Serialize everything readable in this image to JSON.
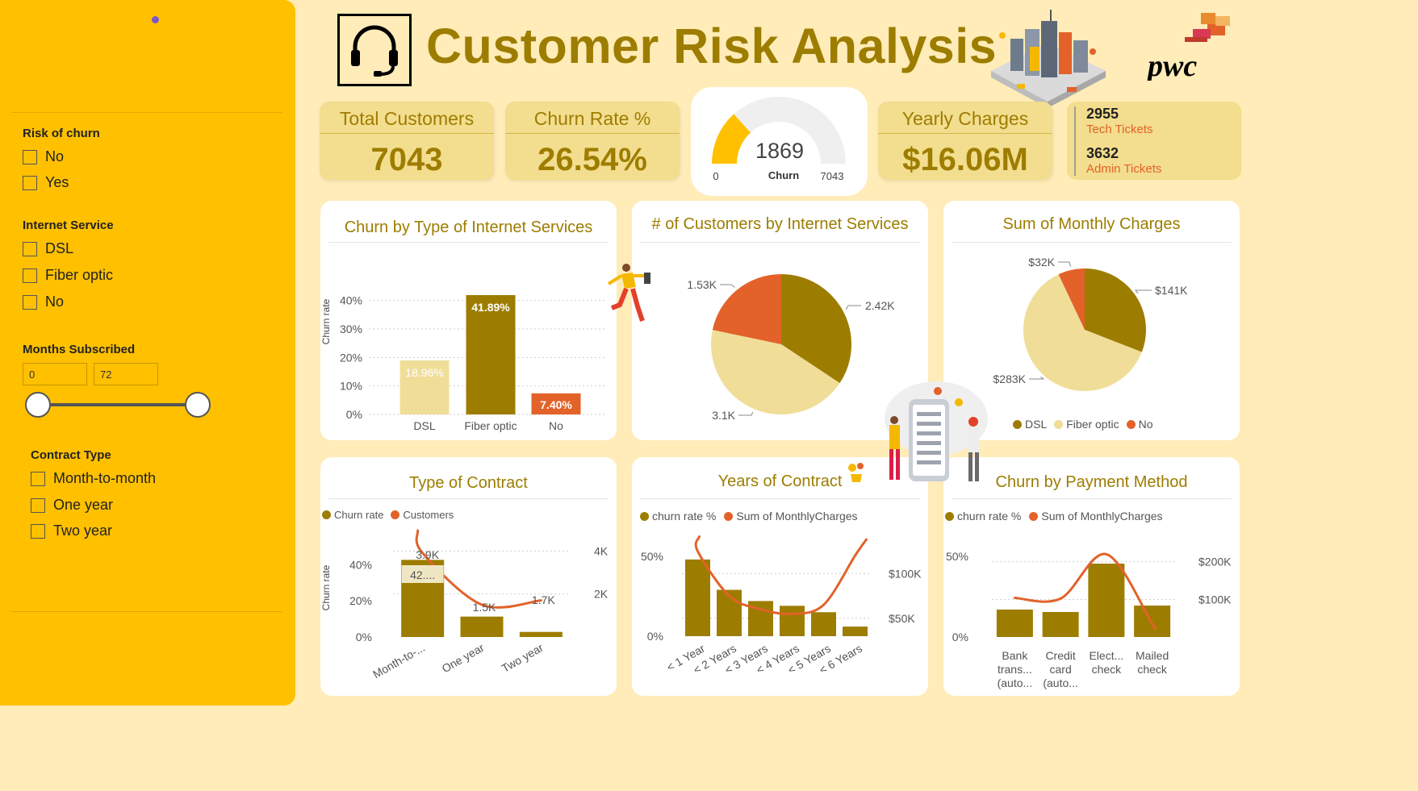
{
  "page_title": "Customer Risk Analysis",
  "pwc_logo_text": "pwc",
  "colors": {
    "sidebar": "#FFC000",
    "background": "#FFECB8",
    "olive": "#9D7D00",
    "light_gold": "#F0DE98",
    "orange": "#E2622A",
    "kpi": "#F3DD8E"
  },
  "sidebar": {
    "risk": {
      "title": "Risk of churn",
      "options": [
        "No",
        "Yes"
      ]
    },
    "internet": {
      "title": "Internet Service",
      "options": [
        "DSL",
        "Fiber optic",
        "No"
      ]
    },
    "months": {
      "title": "Months Subscribed",
      "min": "0",
      "max": "72",
      "slider_min": 0,
      "slider_max": 72,
      "range_min": 0,
      "range_max": 72
    },
    "contract": {
      "title": "Contract Type",
      "options": [
        "Month-to-month",
        "One year",
        "Two year"
      ]
    }
  },
  "kpis": {
    "total_customers": {
      "label": "Total Customers",
      "value": "7043"
    },
    "churn_rate": {
      "label": "Churn Rate %",
      "value": "26.54%"
    },
    "yearly_charges": {
      "label": "Yearly Charges",
      "value": "$16.06M"
    }
  },
  "gauge": {
    "value": "1869",
    "label": "Churn",
    "min": "0",
    "max": "7043",
    "value_num": 1869,
    "max_num": 7043
  },
  "tickets": {
    "tech_count": "2955",
    "tech_label": "Tech Tickets",
    "admin_count": "3632",
    "admin_label": "Admin Tickets"
  },
  "chart_data": [
    {
      "id": "churn_by_internet",
      "type": "bar",
      "title": "Churn by Type of Internet Services",
      "ylabel": "Churn rate",
      "categories": [
        "DSL",
        "Fiber optic",
        "No"
      ],
      "values": [
        18.96,
        41.89,
        7.4
      ],
      "data_labels": [
        "18.96%",
        "41.89%",
        "7.40%"
      ],
      "bar_colors": [
        "#F0DE98",
        "#9D7D00",
        "#E2622A"
      ],
      "yticks": [
        "0%",
        "10%",
        "20%",
        "30%",
        "40%"
      ],
      "ylim": [
        0,
        45
      ],
      "grid": true
    },
    {
      "id": "customers_by_internet",
      "type": "pie",
      "title": "# of Customers by Internet Services",
      "categories": [
        "DSL",
        "Fiber optic",
        "No"
      ],
      "values": [
        2420,
        3100,
        1530
      ],
      "data_labels": [
        "2.42K",
        "3.1K",
        "1.53K"
      ],
      "colors": [
        "#9D7D00",
        "#F0DE98",
        "#E2622A"
      ]
    },
    {
      "id": "monthly_charges_pie",
      "type": "pie",
      "title": "Sum of Monthly Charges",
      "categories": [
        "DSL",
        "Fiber optic",
        "No"
      ],
      "values": [
        141,
        283,
        32
      ],
      "data_labels": [
        "$141K",
        "$283K",
        "$32K"
      ],
      "colors": [
        "#9D7D00",
        "#F0DE98",
        "#E2622A"
      ],
      "legend": [
        "DSL",
        "Fiber optic",
        "No"
      ],
      "legend_position": "bottom"
    },
    {
      "id": "type_of_contract",
      "type": "bar",
      "title": "Type of Contract",
      "ylabel": "Churn rate",
      "legend": [
        "Churn rate",
        "Customers"
      ],
      "categories": [
        "Month-to-...",
        "One year",
        "Two year"
      ],
      "series": [
        {
          "name": "Churn rate",
          "values": [
            42.7,
            11.3,
            2.8
          ],
          "color": "#9D7D00"
        },
        {
          "name": "Customers",
          "values": [
            3900,
            1500,
            1700
          ],
          "color": "#E2622A"
        }
      ],
      "bar_label": "42....",
      "line_labels": [
        "3.9K",
        "1.5K",
        "1.7K"
      ],
      "yticks": [
        "0%",
        "20%",
        "40%"
      ],
      "y2ticks": [
        "2K",
        "4K"
      ],
      "ylim": [
        0,
        50
      ],
      "y2lim": [
        0,
        4200
      ]
    },
    {
      "id": "years_of_contract",
      "type": "bar",
      "title": "Years of Contract",
      "legend": [
        "churn rate %",
        "Sum of MonthlyCharges"
      ],
      "categories": [
        "< 1 Year",
        "< 2 Years",
        "< 3 Years",
        "< 4 Years",
        "< 5 Years",
        "< 6 Years"
      ],
      "series": [
        {
          "name": "churn rate %",
          "values": [
            48,
            29,
            22,
            19,
            15,
            6
          ],
          "color": "#9D7D00"
        },
        {
          "name": "Sum of MonthlyCharges",
          "values": [
            125000,
            75000,
            60000,
            55000,
            65000,
            120000
          ],
          "color": "#E2622A"
        }
      ],
      "yticks": [
        "0%",
        "50%"
      ],
      "y2ticks": [
        "$50K",
        "$100K"
      ],
      "ylim": [
        0,
        56
      ],
      "y2lim": [
        30000,
        130000
      ]
    },
    {
      "id": "churn_by_payment",
      "type": "bar",
      "title": "Churn by Payment Method",
      "legend": [
        "churn rate %",
        "Sum of MonthlyCharges"
      ],
      "categories": [
        [
          "Bank",
          "trans...",
          "(auto..."
        ],
        [
          "Credit",
          "card",
          "(auto..."
        ],
        [
          "Elect...",
          "check"
        ],
        [
          "Mailed",
          "check"
        ]
      ],
      "series": [
        {
          "name": "churn rate %",
          "values": [
            17,
            15.5,
            45.5,
            19.5
          ],
          "color": "#9D7D00"
        },
        {
          "name": "Sum of MonthlyCharges",
          "values": [
            104000,
            102000,
            220000,
            35000
          ],
          "color": "#E2622A"
        }
      ],
      "yticks": [
        "0%",
        "50%"
      ],
      "y2ticks": [
        "$100K",
        "$200K"
      ],
      "ylim": [
        0,
        56
      ],
      "y2lim": [
        0,
        240000
      ]
    }
  ]
}
